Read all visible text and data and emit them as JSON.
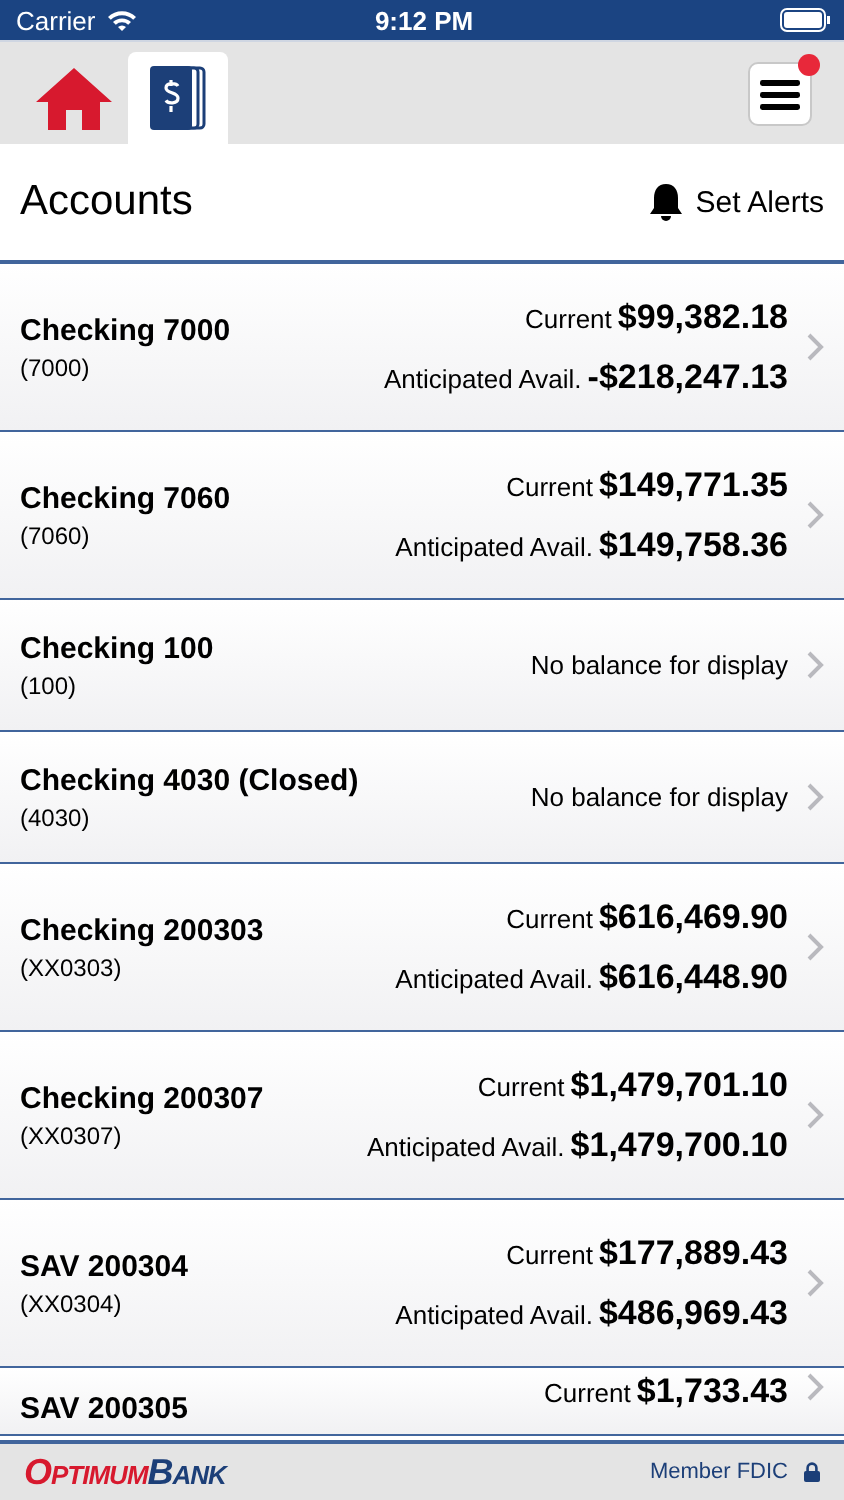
{
  "status_bar": {
    "carrier": "Carrier",
    "time": "9:12 PM"
  },
  "tabs": [
    {
      "kind": "home",
      "selected": false
    },
    {
      "kind": "accounts",
      "selected": true
    }
  ],
  "menu": {
    "notification": true
  },
  "header": {
    "title": "Accounts",
    "action": "Set Alerts"
  },
  "accounts": [
    {
      "kind": "balances",
      "name": "Checking 7000",
      "number": "(7000)",
      "current_label": "Current",
      "current": "$99,382.18",
      "avail_label": "Anticipated Avail.",
      "avail": "-$218,247.13"
    },
    {
      "kind": "balances",
      "name": "Checking 7060",
      "number": "(7060)",
      "current_label": "Current",
      "current": "$149,771.35",
      "avail_label": "Anticipated Avail.",
      "avail": "$149,758.36"
    },
    {
      "kind": "none",
      "name": "Checking 100",
      "number": "(100)",
      "message": "No balance for display"
    },
    {
      "kind": "none",
      "name": "Checking 4030 (Closed)",
      "number": "(4030)",
      "message": "No balance for display"
    },
    {
      "kind": "balances",
      "name": "Checking 200303",
      "number": "(XX0303)",
      "current_label": "Current",
      "current": "$616,469.90",
      "avail_label": "Anticipated Avail.",
      "avail": "$616,448.90"
    },
    {
      "kind": "balances",
      "name": "Checking 200307",
      "number": "(XX0307)",
      "current_label": "Current",
      "current": "$1,479,701.10",
      "avail_label": "Anticipated Avail.",
      "avail": "$1,479,700.10"
    },
    {
      "kind": "balances",
      "name": "SAV 200304",
      "number": "(XX0304)",
      "current_label": "Current",
      "current": "$177,889.43",
      "avail_label": "Anticipated Avail.",
      "avail": "$486,969.43"
    },
    {
      "kind": "partial",
      "name": "SAV 200305",
      "current_label": "Current",
      "current": "$1,733.43"
    }
  ],
  "footer": {
    "logo_first": "Optimum",
    "logo_second": "Bank",
    "fdic": "Member FDIC"
  }
}
